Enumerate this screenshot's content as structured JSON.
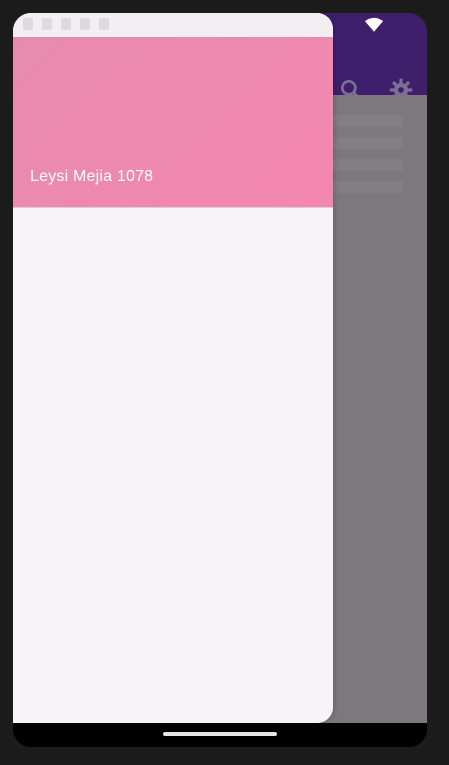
{
  "colors": {
    "app_bar": "#3f1f6b",
    "drawer_header_start": "#e78bae",
    "drawer_header_end": "#f487b0",
    "drawer_background": "#f7f4f8",
    "scrim_content": "#7b797c"
  },
  "icons": {
    "search": "search-icon",
    "settings": "gear-icon",
    "wifi": "wifi-icon"
  },
  "drawer": {
    "header_title": "Leysi Mejia 1078"
  }
}
